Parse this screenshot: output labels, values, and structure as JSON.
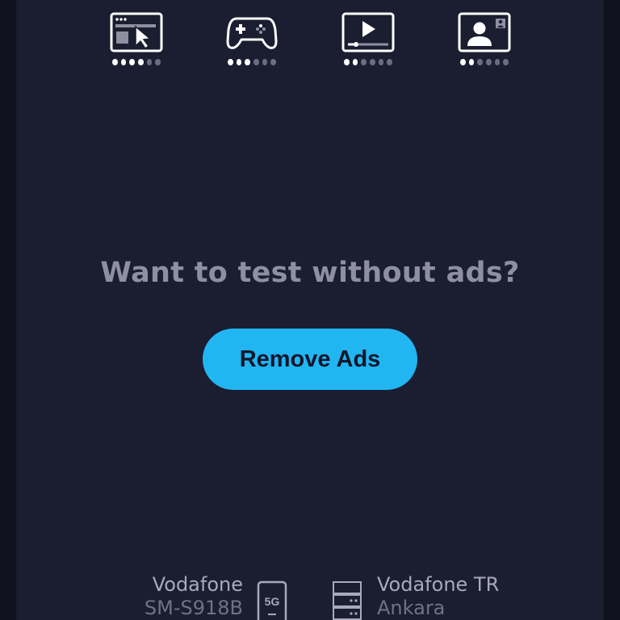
{
  "metrics": [
    {
      "icon": "browser-cursor-icon",
      "level": 4,
      "max": 6
    },
    {
      "icon": "gamepad-icon",
      "level": 3,
      "max": 6
    },
    {
      "icon": "video-player-icon",
      "level": 2,
      "max": 6
    },
    {
      "icon": "video-call-icon",
      "level": 2,
      "max": 6
    }
  ],
  "prompt": "Want to test without ads?",
  "remove_ads_button": "Remove Ads",
  "footer": {
    "carrier": "Vodafone",
    "device": "SM-S918B",
    "network_badge": "5G",
    "provider": "Vodafone TR",
    "server_location": "Ankara"
  },
  "colors": {
    "background": "#1b1d30",
    "accent": "#21b6f2",
    "dot_active": "#ffffff",
    "dot_inactive": "#6b6e80"
  }
}
